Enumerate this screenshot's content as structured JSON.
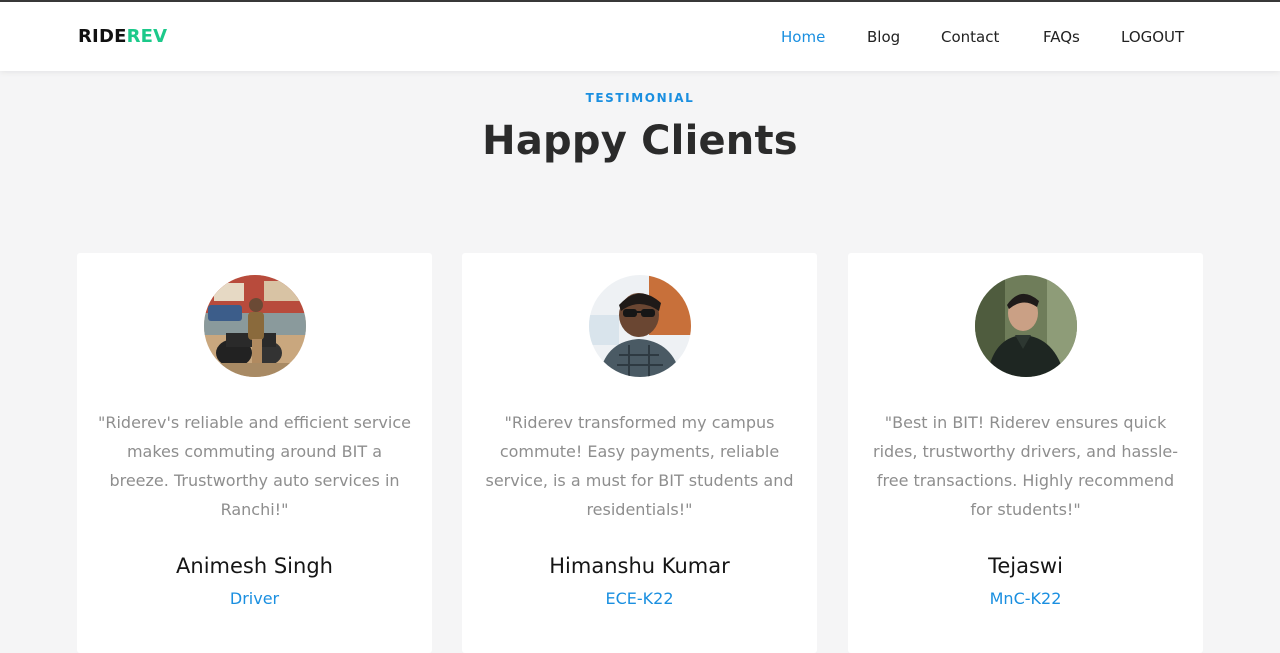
{
  "header": {
    "logo_part1": "RIDE",
    "logo_part2": "REV",
    "nav": [
      {
        "label": "Home",
        "active": true
      },
      {
        "label": "Blog",
        "active": false
      },
      {
        "label": "Contact",
        "active": false
      },
      {
        "label": "FAQs",
        "active": false
      },
      {
        "label": "LOGOUT",
        "active": false
      }
    ]
  },
  "section": {
    "eyebrow": "TESTIMONIAL",
    "title": "Happy Clients"
  },
  "testimonials": [
    {
      "quote": "\"Riderev's reliable and efficient service makes commuting around BIT a breeze. Trustworthy auto services in Ranchi!\"",
      "name": "Animesh Singh",
      "role": "Driver"
    },
    {
      "quote": "\"Riderev transformed my campus commute! Easy payments, reliable service, is a must for BIT students and residentials!\"",
      "name": "Himanshu Kumar",
      "role": "ECE-K22"
    },
    {
      "quote": "\"Best in BIT! Riderev ensures quick rides, trustworthy drivers, and hassle-free transactions. Highly recommend for students!\"",
      "name": "Tejaswi",
      "role": "MnC-K22"
    }
  ],
  "colors": {
    "accent": "#1a8fe0",
    "brand_green": "#1cc98a",
    "page_bg": "#f5f5f6",
    "muted_text": "#8e8e8e"
  }
}
